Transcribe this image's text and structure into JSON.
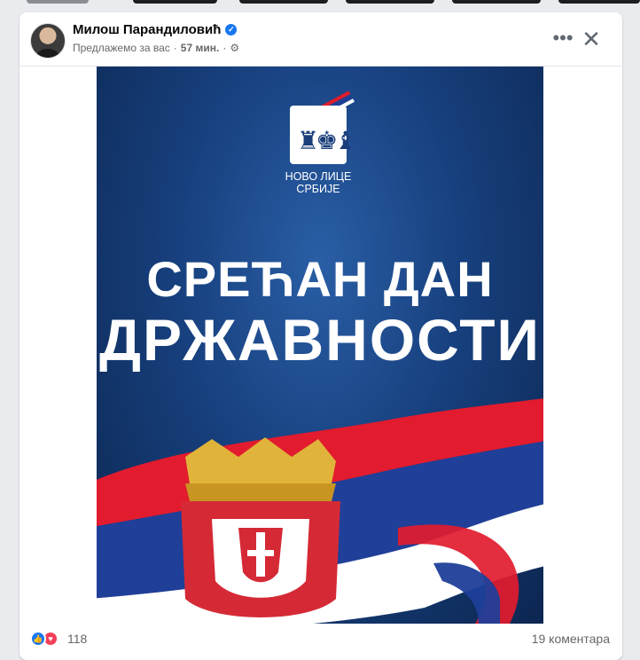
{
  "post": {
    "author": "Милош Парандиловић",
    "verified_icon": "verified-badge-icon",
    "suggested": "Предлажемо за вас",
    "separator": "·",
    "time": "57 мин.",
    "audience_icon": "gear-icon",
    "more_icon": "more-options-icon",
    "close_icon": "close-icon"
  },
  "image": {
    "logo_line1": "НОВО ЛИЦЕ",
    "logo_line2": "СРБИЈЕ",
    "headline_line1": "СРЕЋАН ДАН",
    "headline_line2": "ДРЖАВНОСТИ",
    "flag_colors": [
      "#e21b2e",
      "#1f3f99",
      "#ffffff"
    ],
    "background_color": "#17407e"
  },
  "footer": {
    "reaction_count": "118",
    "comments": "19 коментара",
    "reaction_icons": [
      "like-icon",
      "love-icon"
    ]
  }
}
